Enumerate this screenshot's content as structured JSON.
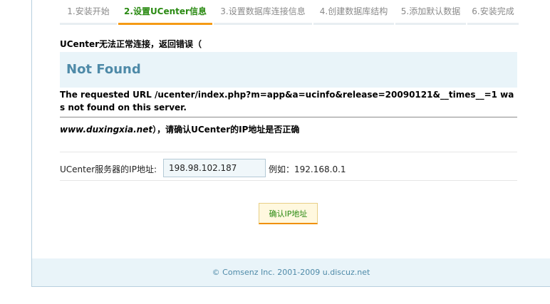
{
  "steps": [
    {
      "label": "1.安装开始"
    },
    {
      "label": "2.设置UCenter信息"
    },
    {
      "label": "3.设置数据库连接信息"
    },
    {
      "label": "4.创建数据库结构"
    },
    {
      "label": "5.添加默认数据"
    },
    {
      "label": "6.安装完成"
    }
  ],
  "active_step": 1,
  "error": {
    "line1": "UCenter无法正常连接，返回错误（",
    "title": "Not Found",
    "message": "The requested URL /ucenter/index.php?m=app&a=ucinfo&release=20090121&__times__=1 was not found on this server.",
    "host": "www.duxingxia.net",
    "line2_suffix": "），请确认UCenter的IP地址是否正确"
  },
  "form": {
    "ip_label": "UCenter服务器的IP地址:",
    "ip_value": "198.98.102.187",
    "ip_example": "例如：192.168.0.1"
  },
  "confirm_button": "确认IP地址",
  "footer": "© Comsenz Inc. 2001-2009 u.discuz.net",
  "colors": {
    "active_step_text": "#2a8a12",
    "active_step_underline": "#f59b16",
    "notfound_bg": "#e9f4f9",
    "notfound_text": "#4e8aa8"
  }
}
